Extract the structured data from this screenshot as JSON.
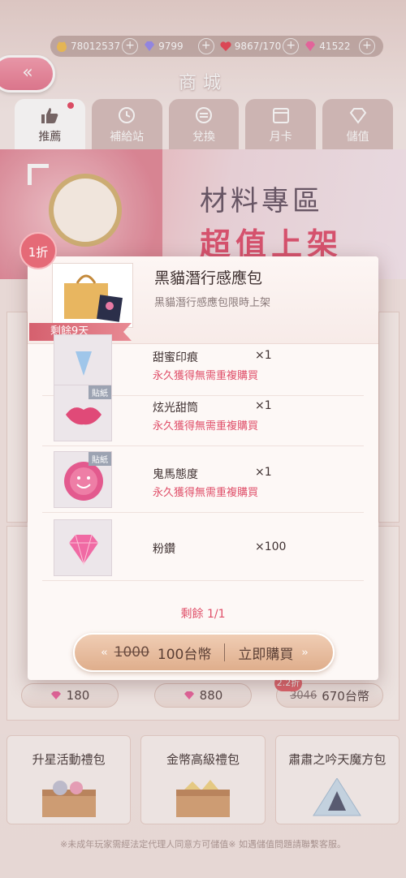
{
  "currencies": [
    {
      "icon": "cat-coin-icon",
      "value": "78012537"
    },
    {
      "icon": "diamond-icon",
      "value": "9799"
    },
    {
      "icon": "heart-icon",
      "value": "9867/170"
    },
    {
      "icon": "pink-diamond-icon",
      "value": "41522"
    }
  ],
  "header": {
    "title": "商城"
  },
  "tabs": [
    "推薦",
    "補給站",
    "兌換",
    "月卡",
    "儲值"
  ],
  "banner": {
    "line1": "材料專區",
    "line2": "超值上架"
  },
  "modal": {
    "discount": "1折",
    "title": "黑貓潛行感應包",
    "subtitle": "黑貓潛行感應包限時上架",
    "remaining_days": "剩餘9天",
    "items": [
      {
        "name": "甜蜜印痕",
        "qty": "×1",
        "note": "永久獲得無需重複購買",
        "tag": ""
      },
      {
        "name": "炫光甜筒",
        "qty": "×1",
        "note": "永久獲得無需重複購買",
        "tag": "貼紙"
      },
      {
        "name": "鬼馬態度",
        "qty": "×1",
        "note": "永久獲得無需重複購買",
        "tag": "貼紙"
      },
      {
        "name": "粉鑽",
        "qty": "×100",
        "note": "",
        "tag": ""
      }
    ],
    "remaining_count": "剩餘 1/1",
    "buy": {
      "old_price": "1000",
      "new_price": "100台幣",
      "label": "立即購買"
    }
  },
  "prices": {
    "p1": "180",
    "p2": "880",
    "p3_old": "3046",
    "p3_new": "670台幣",
    "p3_discount": "2.2折"
  },
  "packs": [
    "升星活動禮包",
    "金幣高級禮包",
    "肅肅之吟天魔方包"
  ],
  "footer": "※未成年玩家需經法定代理人同意方可儲值※ 如遇儲值問題請聯繫客服。",
  "colors": {
    "accent_pink": "#e0506a",
    "buy_button": "#dfae8c"
  }
}
